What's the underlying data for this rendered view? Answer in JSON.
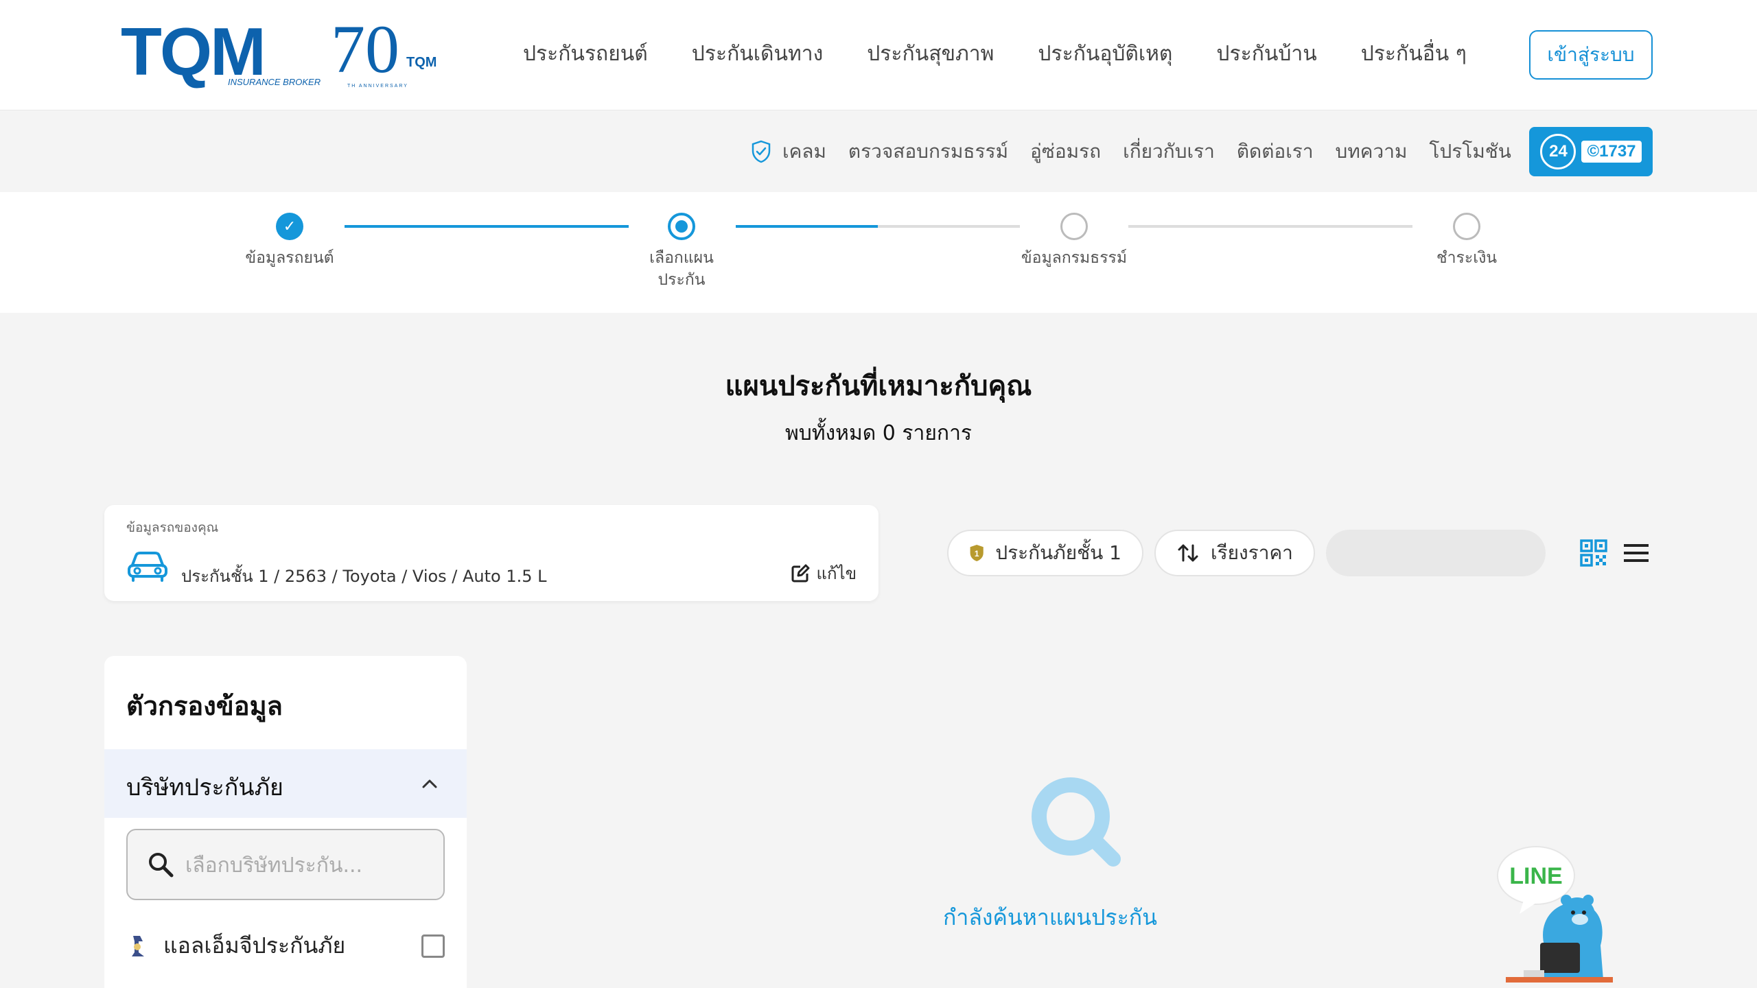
{
  "header": {
    "logo_text": "TQM",
    "logo_sub": "INSURANCE BROKER",
    "anniv_number": "70",
    "anniv_brand": "TQM",
    "anniv_sub": "TH ANNIVERSARY",
    "nav": [
      {
        "label": "ประกันรถยนต์"
      },
      {
        "label": "ประกันเดินทาง"
      },
      {
        "label": "ประกันสุขภาพ"
      },
      {
        "label": "ประกันอุบัติเหตุ"
      },
      {
        "label": "ประกันบ้าน"
      },
      {
        "label": "ประกันอื่น ๆ"
      }
    ],
    "login_label": "เข้าสู่ระบบ"
  },
  "subnav": {
    "items": [
      {
        "label": "เคลม"
      },
      {
        "label": "ตรวจสอบกรมธรรม์"
      },
      {
        "label": "อู่ซ่อมรถ"
      },
      {
        "label": "เกี่ยวกับเรา"
      },
      {
        "label": "ติดต่อเรา"
      },
      {
        "label": "บทความ"
      },
      {
        "label": "โปรโมชัน"
      }
    ],
    "hotline_24": "24",
    "hotline_number": "©1737"
  },
  "stepper": {
    "steps": [
      {
        "label": "ข้อมูลรถยนต์",
        "state": "done"
      },
      {
        "label": "เลือกแผนประกัน",
        "state": "active"
      },
      {
        "label": "ข้อมูลกรมธรรม์",
        "state": "todo"
      },
      {
        "label": "ชำระเงิน",
        "state": "todo"
      }
    ]
  },
  "main": {
    "title": "แผนประกันที่เหมาะกับคุณ",
    "count_text": "พบทั้งหมด 0 รายการ"
  },
  "car": {
    "label": "ข้อมูลรถของคุณ",
    "description": "ประกันชั้น 1 / 2563 / Toyota / Vios / Auto 1.5 L",
    "edit_label": "แก้ไข"
  },
  "toolbar": {
    "class_chip": "ประกันภัยชั้น 1",
    "sort_chip": "เรียงราคา"
  },
  "filter": {
    "title": "ตัวกรองข้อมูล",
    "section_title": "บริษัทประกันภัย",
    "search_placeholder": "เลือกบริษัทประกัน...",
    "insurers": [
      {
        "name": "แอลเอ็มจีประกันภัย",
        "checked": false
      }
    ]
  },
  "loading": {
    "text": "กำลังค้นหาแผนประกัน"
  },
  "line_widget": {
    "label": "LINE"
  },
  "colors": {
    "brand": "#0d62ad",
    "accent": "#1597da",
    "line_green": "#3ab54a"
  }
}
